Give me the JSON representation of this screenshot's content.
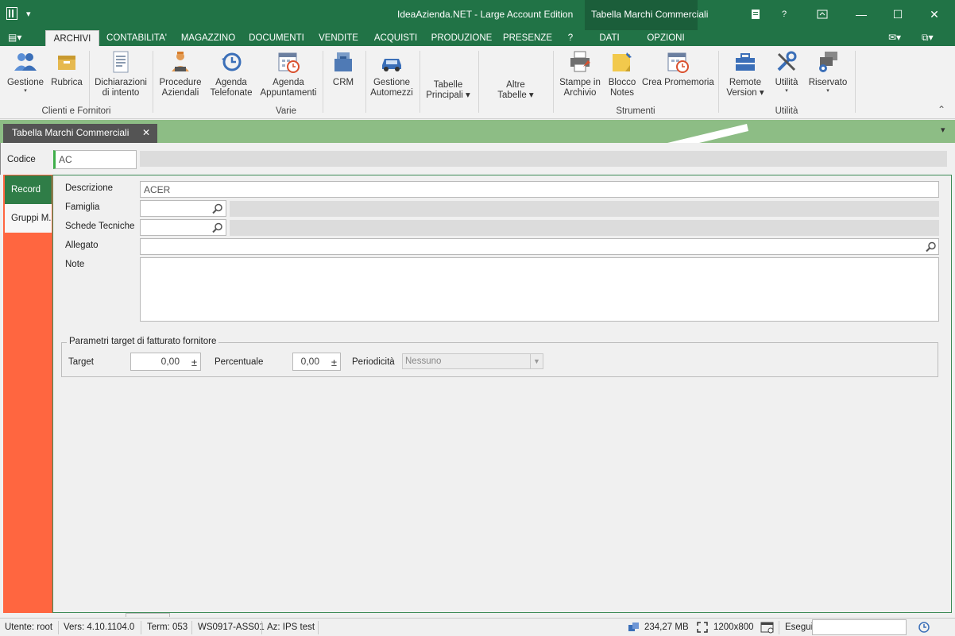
{
  "window": {
    "title": "IdeaAzienda.NET - Large Account Edition",
    "context_title": "Tabella Marchi Commerciali",
    "minimize": "—",
    "maximize": "☐",
    "close": "✕",
    "help": "?"
  },
  "ribbon_tabs": [
    "ARCHIVI",
    "CONTABILITA'",
    "MAGAZZINO",
    "DOCUMENTI",
    "VENDITE",
    "ACQUISTI",
    "PRODUZIONE",
    "PRESENZE",
    "?",
    "DATI",
    "OPZIONI"
  ],
  "ribbon": {
    "buttons": [
      {
        "label": "Gestione",
        "label2": "",
        "arrow": "▾",
        "icon": "people-icon"
      },
      {
        "label": "Rubrica",
        "label2": "",
        "arrow": "",
        "icon": "address-book-icon"
      },
      {
        "label": "Dichiarazioni",
        "label2": "di intento",
        "arrow": "",
        "icon": "document-icon"
      },
      {
        "label": "Procedure",
        "label2": "Aziendali",
        "arrow": "",
        "icon": "worker-icon"
      },
      {
        "label": "Agenda",
        "label2": "Telefonate",
        "arrow": "",
        "icon": "history-clock-icon"
      },
      {
        "label": "Agenda",
        "label2": "Appuntamenti",
        "arrow": "",
        "icon": "calendar-clock-icon"
      },
      {
        "label": "CRM",
        "label2": "",
        "arrow": "",
        "icon": "briefcases-icon"
      },
      {
        "label": "Gestione",
        "label2": "Automezzi",
        "arrow": "",
        "icon": "car-icon"
      },
      {
        "label": "Tabelle",
        "label2": "Principali ▾",
        "arrow": "",
        "icon": ""
      },
      {
        "label": "Altre",
        "label2": "Tabelle ▾",
        "arrow": "",
        "icon": ""
      },
      {
        "label": "Stampe in",
        "label2": "Archivio",
        "arrow": "",
        "icon": "printer-icon"
      },
      {
        "label": "Blocco",
        "label2": "Notes",
        "arrow": "",
        "icon": "sticky-note-icon"
      },
      {
        "label": "Crea Promemoria",
        "label2": "",
        "arrow": "",
        "icon": "calendar-clock-icon"
      },
      {
        "label": "Remote",
        "label2": "Version ▾",
        "arrow": "",
        "icon": "toolbox-icon"
      },
      {
        "label": "Utilità",
        "label2": "",
        "arrow": "▾",
        "icon": "tools-icon"
      },
      {
        "label": "Riservato",
        "label2": "",
        "arrow": "▾",
        "icon": "gear-windows-icon"
      }
    ],
    "groups": [
      "Clienti e Fornitori",
      "Varie",
      "Strumenti",
      "Utilità"
    ],
    "collapse": "⌃"
  },
  "doc_tab": {
    "label": "Tabella Marchi Commerciali",
    "close": "✕",
    "menu": "▾"
  },
  "form": {
    "codice_label": "Codice",
    "codice_value": "AC",
    "side_tabs": [
      "Record",
      "Gruppi M."
    ],
    "descrizione_label": "Descrizione",
    "descrizione_value": "ACER",
    "famiglia_label": "Famiglia",
    "schede_label": "Schede Tecniche",
    "allegato_label": "Allegato",
    "note_label": "Note",
    "params_legend": "Parametri target di fatturato fornitore",
    "target_label": "Target",
    "target_value": "0,00",
    "percentuale_label": "Percentuale",
    "percentuale_value": "0,00",
    "periodicita_label": "Periodicità",
    "periodicita_value": "Nessuno",
    "spin_symbol": "±"
  },
  "status": {
    "utente": "Utente: root",
    "versione": "Vers: 4.10.1104.0",
    "term": "Term: 053",
    "workstation": "WS0917-ASS01",
    "azienda": "Az: IPS test",
    "memory": "234,27 MB",
    "resolution": "1200x800",
    "esegui": "Esegui"
  },
  "colors": {
    "brand": "#217346",
    "accent_orange": "#ff6640",
    "tabstrip": "#8dbd85"
  }
}
